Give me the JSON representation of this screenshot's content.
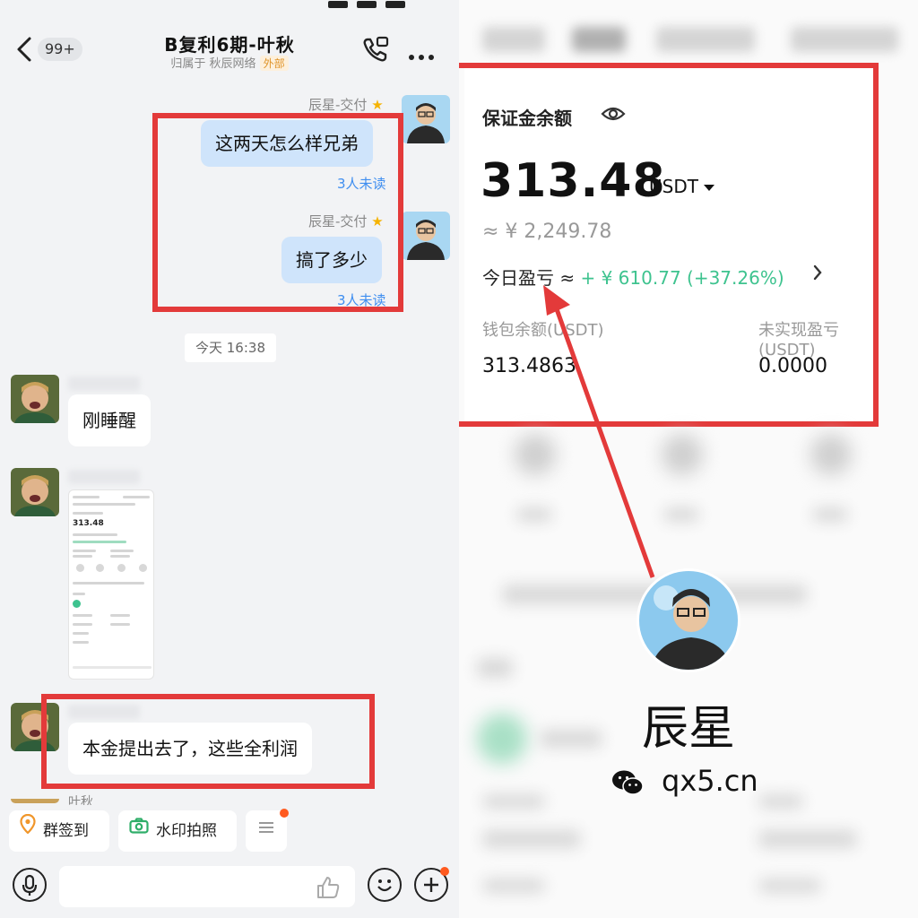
{
  "chat": {
    "title": "B复利6期-叶秋",
    "subtitle": "归属于 秋辰网络",
    "external_tag": "外部",
    "unread_count": "99+",
    "sender_name": "辰星-交付",
    "messages": [
      {
        "text": "这两天怎么样兄弟",
        "status": "3人未读"
      },
      {
        "text": "搞了多少",
        "status": "3人未读"
      }
    ],
    "time_divider": "今天 16:38",
    "incoming": [
      {
        "text": "刚睡醒"
      },
      {
        "text": "本金提出去了，这些全利润"
      }
    ],
    "thumb": {
      "balance": "313.48"
    },
    "next_sender": "叶秋",
    "quick_actions": [
      {
        "label": "群签到",
        "icon": "location-pin-icon"
      },
      {
        "label": "水印拍照",
        "icon": "camera-icon"
      }
    ],
    "input_placeholder": ""
  },
  "wallet": {
    "label": "保证金余额",
    "balance": "313.48",
    "unit": "USDT",
    "cny_approx": "≈ ¥ 2,249.78",
    "today_pnl_label": "今日盈亏 ≈ ",
    "today_pnl_value": "+ ¥ 610.77 (+37.26%)",
    "wallet_balance_label": "钱包余额(USDT)",
    "wallet_balance_value": "313.4863",
    "unrealized_label": "未实现盈亏(USDT)",
    "unrealized_value": "0.0000"
  },
  "watermark": {
    "name": "辰星",
    "site": "qx5.cn"
  },
  "colors": {
    "highlight_red": "#e33a3a",
    "profit_green": "#3ec38f",
    "outgoing_bubble": "#cfe4fb",
    "link_blue": "#3f8ef0"
  }
}
